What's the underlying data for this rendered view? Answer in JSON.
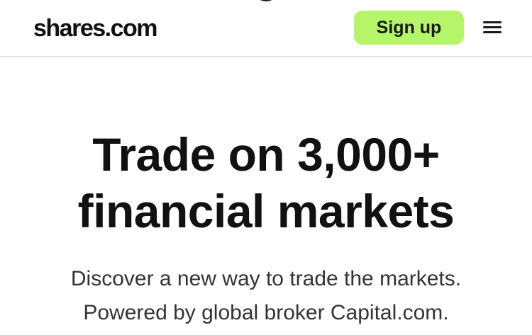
{
  "header": {
    "logo_text": "shares.com",
    "signup_label": "Sign up",
    "menu_icon": "hamburger-menu-icon"
  },
  "hero": {
    "title_line1": "Trade on 3,000+",
    "title_line2": "financial markets",
    "subtitle_line1": "Discover a new way to trade the markets.",
    "subtitle_line2": "Powered by global broker Capital.com."
  },
  "colors": {
    "signup_bg": "#b5f56a",
    "text": "#111111",
    "subtitle_text": "#333333",
    "divider": "#e6e6e6"
  }
}
